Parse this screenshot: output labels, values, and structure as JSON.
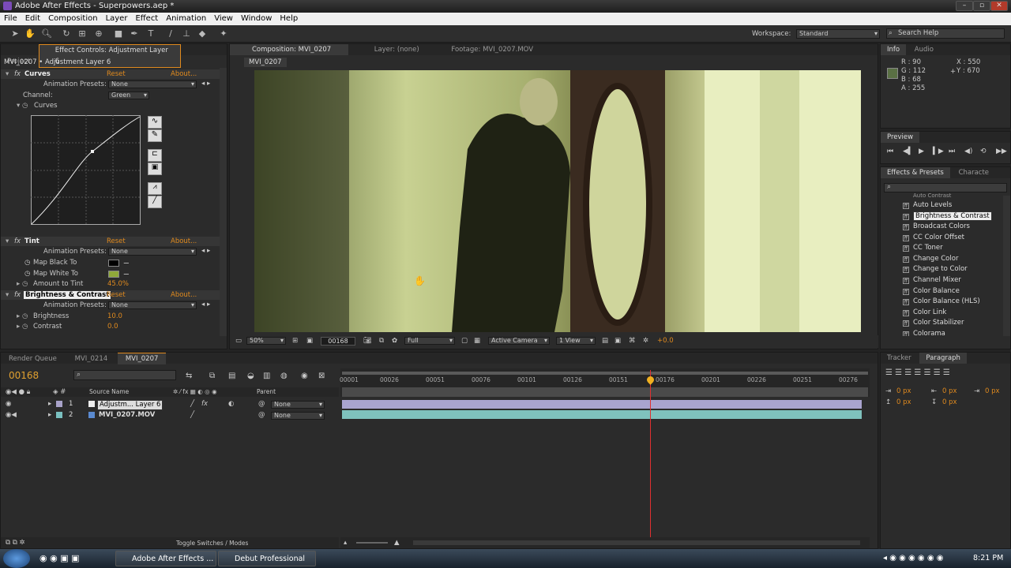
{
  "window": {
    "title": "Adobe After Effects - Superpowers.aep *"
  },
  "menu": [
    "File",
    "Edit",
    "Composition",
    "Layer",
    "Effect",
    "Animation",
    "View",
    "Window",
    "Help"
  ],
  "toolbar": {
    "workspace_label": "Workspace:",
    "workspace_value": "Standard",
    "search_placeholder": "Search Help"
  },
  "left_panel": {
    "tabs": [
      "Project",
      "Effect Controls: Adjustment Layer 6"
    ],
    "header": "MVI_0207 • Adjustment Layer 6",
    "curves": {
      "name": "Curves",
      "reset": "Reset",
      "about": "About...",
      "anim_label": "Animation Presets:",
      "anim_value": "None",
      "channel_label": "Channel:",
      "channel_value": "Green",
      "curves_label": "Curves"
    },
    "tint": {
      "name": "Tint",
      "reset": "Reset",
      "about": "About...",
      "anim_label": "Animation Presets:",
      "anim_value": "None",
      "map_black": "Map Black To",
      "map_white": "Map White To",
      "amount_label": "Amount to Tint",
      "amount_value": "45.0%"
    },
    "bc": {
      "name": "Brightness & Contrast",
      "reset": "Reset",
      "about": "About...",
      "anim_label": "Animation Presets:",
      "anim_value": "None",
      "brightness_label": "Brightness",
      "brightness_value": "10.0",
      "contrast_label": "Contrast",
      "contrast_value": "0.0"
    }
  },
  "comp_panel": {
    "tabs": [
      "Composition: MVI_0207",
      "Layer: (none)",
      "Footage: MVI_0207.MOV"
    ],
    "subtab": "MVI_0207",
    "zoom": "50%",
    "timecode": "00168",
    "resolution": "Full",
    "camera": "Active Camera",
    "views": "1 View",
    "exposure": "+0.0"
  },
  "info": {
    "tabs": [
      "Info",
      "Audio"
    ],
    "r": "R : 90",
    "g": "G : 112",
    "b": "B : 68",
    "a": "A : 255",
    "x": "X : 550",
    "y": "Y : 670"
  },
  "preview": {
    "title": "Preview"
  },
  "effects_presets": {
    "tabs": [
      "Effects & Presets",
      "Characte"
    ],
    "items": [
      "Auto Levels",
      "Brightness & Contrast",
      "Broadcast Colors",
      "CC Color Offset",
      "CC Toner",
      "Change Color",
      "Change to Color",
      "Channel Mixer",
      "Color Balance",
      "Color Balance (HLS)",
      "Color Link",
      "Color Stabilizer",
      "Colorama"
    ],
    "partial": "Auto Contrast"
  },
  "timeline": {
    "tabs": [
      "Render Queue",
      "MVI_0214",
      "MVI_0207"
    ],
    "timecode": "00168",
    "col_source": "Source Name",
    "col_parent": "Parent",
    "layers": [
      {
        "num": "1",
        "name": "Adjustm... Layer 6",
        "parent": "None"
      },
      {
        "num": "2",
        "name": "MVI_0207.MOV",
        "parent": "None"
      }
    ],
    "ticks": [
      "00001",
      "00026",
      "00051",
      "00076",
      "00101",
      "00126",
      "00151",
      "00176",
      "00201",
      "00226",
      "00251",
      "00276"
    ],
    "toggle_label": "Toggle Switches / Modes"
  },
  "tracker": {
    "tabs": [
      "Tracker",
      "Paragraph"
    ],
    "px1": "0 px",
    "px2": "0 px",
    "px3": "0 px",
    "px4": "0 px",
    "px5": "0 px"
  },
  "taskbar": {
    "items": [
      "Adobe After Effects ...",
      "Debut Professional"
    ],
    "time": "8:21 PM"
  }
}
